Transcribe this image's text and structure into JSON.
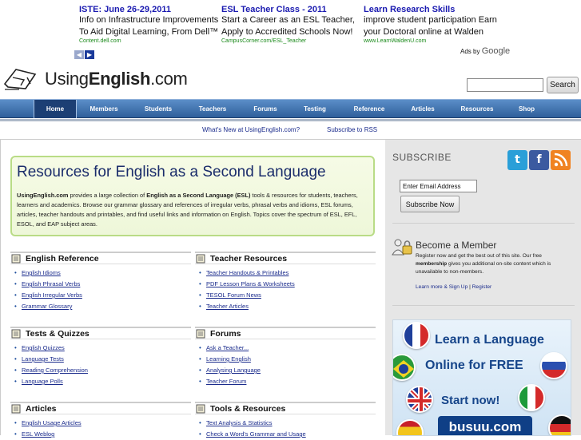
{
  "ads": [
    {
      "title": "ISTE: June 26-29,2011",
      "text": "Info on Infrastructure Improvements To Aid Digital Learning, From Dell™",
      "url": "Content.dell.com"
    },
    {
      "title": "ESL Teacher Class - 2011",
      "text": "Start a Career as an ESL Teacher, Apply to Accredited Schools Now!",
      "url": "CampusCorner.com/ESL_Teacher"
    },
    {
      "title": "Learn Research Skills",
      "text": "improve student participation Earn your Doctoral online at Walden",
      "url": "www.LearnWaldenU.com"
    }
  ],
  "ads_by": {
    "prefix": "Ads by",
    "brand": "Google"
  },
  "site": {
    "logo_plain": "Using",
    "logo_bold": "English",
    "logo_suffix": ".com"
  },
  "search": {
    "button": "Search",
    "value": ""
  },
  "nav": [
    "Home",
    "Members",
    "Students",
    "Teachers",
    "Forums",
    "Testing",
    "Reference",
    "Articles",
    "Resources",
    "Shop"
  ],
  "subnav": [
    "What's New at UsingEnglish.com?",
    "Subscribe to RSS"
  ],
  "intro": {
    "title": "Resources for English as a Second Language",
    "site_name": "UsingEnglish.com",
    "text_1": " provides a large collection of ",
    "text_bold": "English as a Second Language (ESL)",
    "text_2": " tools & resources for students, teachers, learners and academics. Browse our grammar glossary and references of irregular verbs, phrasal verbs and idioms, ESL forums, articles, teacher handouts and printables, and find useful links and information on English. Topics cover the spectrum of ESL, EFL, ESOL, and EAP subject areas."
  },
  "sections": [
    {
      "title": "English Reference",
      "items": [
        "English Idioms",
        "English Phrasal Verbs",
        "English Irregular Verbs",
        "Grammar Glossary"
      ]
    },
    {
      "title": "Teacher Resources",
      "items": [
        "Teacher Handouts & Printables",
        "PDF Lesson Plans & Worksheets",
        "TESOL Forum News",
        "Teacher Articles"
      ]
    },
    {
      "title": "Tests & Quizzes",
      "items": [
        "English Quizzes",
        "Language Tests",
        "Reading Comprehension",
        "Language Polls"
      ]
    },
    {
      "title": "Forums",
      "items": [
        "Ask a Teacher...",
        "Learning English",
        "Analysing Language",
        "Teacher Forum"
      ]
    },
    {
      "title": "Articles",
      "items": [
        "English Usage Articles",
        "ESL Weblog"
      ]
    },
    {
      "title": "Tools & Resources",
      "items": [
        "Text Analysis & Statistics",
        "Check a Word's Grammar and Usage"
      ]
    }
  ],
  "sidebar": {
    "subscribe_title": "SUBSCRIBE",
    "email_value": "Enter Email Address",
    "subscribe_button": "Subscribe Now",
    "member_title": "Become a Member",
    "member_text_1": "Register now and get the best out of this site. Our free ",
    "member_text_bold": "membership",
    "member_text_2": " gives you additional on-site content which is unavailable to non-members.",
    "learn_more": "Learn more & Sign Up",
    "separator": "|",
    "register": "Register"
  },
  "busuu": {
    "line1": "Learn a Language",
    "line2": "Online for FREE",
    "line3": "Start now!",
    "brand": "busuu.com"
  },
  "colors": {
    "twitter": "#2a9fd8",
    "facebook": "#3b5aa0",
    "rss": "#f08322",
    "nav": "#3a6aa8",
    "intro_border": "#b9dc86"
  }
}
